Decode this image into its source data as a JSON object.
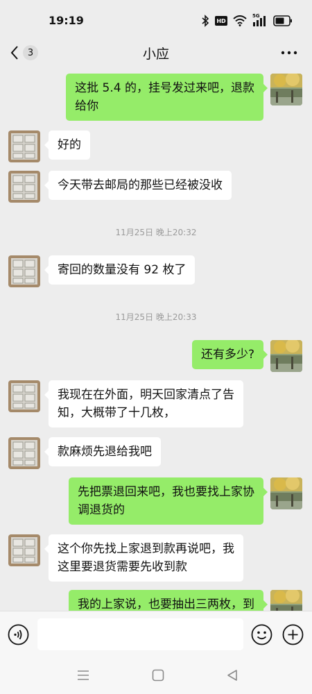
{
  "status_bar": {
    "time": "19:19",
    "icons": [
      "bluetooth-icon",
      "hd-icon",
      "wifi-icon",
      "5g-signal-icon",
      "battery-icon"
    ],
    "hd_label": "HD",
    "network_label": "5G"
  },
  "header": {
    "back_icon": "chevron-left-icon",
    "unread_count": "3",
    "title": "小应",
    "more_icon": "more-dots-icon"
  },
  "messages": [
    {
      "side": "right",
      "lines": [
        "这批 5.4 的，挂号发过来吧，退款",
        "给你"
      ]
    },
    {
      "side": "left",
      "lines": [
        "好的"
      ]
    },
    {
      "side": "left",
      "lines": [
        "今天带去邮局的那些已经被没收"
      ]
    },
    {
      "time": "11月25日 晚上20:32"
    },
    {
      "side": "left",
      "lines": [
        "寄回的数量没有 92 枚了"
      ]
    },
    {
      "time": "11月25日 晚上20:33"
    },
    {
      "side": "right",
      "lines": [
        "还有多少?"
      ]
    },
    {
      "side": "left",
      "lines": [
        "我现在在外面，明天回家清点了告",
        "知，大概带了十几枚，"
      ]
    },
    {
      "side": "left",
      "lines": [
        "款麻烦先退给我吧"
      ]
    },
    {
      "side": "right",
      "lines": [
        "先把票退回来吧，我也要找上家协",
        "调退货的"
      ]
    },
    {
      "side": "left",
      "lines": [
        "这个你先找上家退到款再说吧，我",
        "这里要退货需要先收到款"
      ]
    },
    {
      "side": "right",
      "lines": [
        "我的上家说，也要抽出三两枚，到"
      ]
    }
  ],
  "input_bar": {
    "voice_icon": "voice-input-icon",
    "text_value": "",
    "emoji_icon": "emoji-icon",
    "plus_icon": "plus-icon"
  },
  "system_nav": {
    "icons": [
      "menu-icon",
      "home-icon",
      "back-icon"
    ]
  },
  "colors": {
    "background": "#ededed",
    "sent_bubble": "#95ec69",
    "received_bubble": "#ffffff",
    "timestamp": "#9a9a9a"
  }
}
